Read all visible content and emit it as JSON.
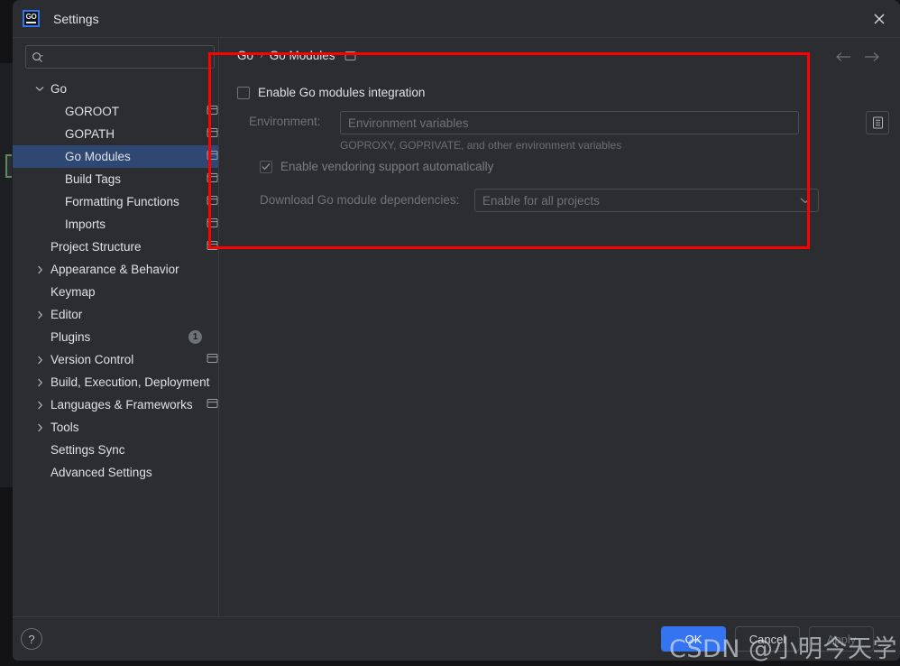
{
  "window": {
    "title": "Settings",
    "app_icon": "goland-go-icon",
    "icon_text": "GO",
    "close_icon": "close-icon",
    "accent_color": "#3574f0",
    "selection_color": "#2f4773",
    "annotation_color": "#fe0000"
  },
  "search": {
    "placeholder": "",
    "value": "",
    "icon": "search-icon"
  },
  "sidebar": {
    "items": [
      {
        "label": "Go",
        "level": 0,
        "arrow": "chevron-down",
        "scope_icon": false,
        "selected": false
      },
      {
        "label": "GOROOT",
        "level": 1,
        "arrow": "",
        "scope_icon": true,
        "selected": false
      },
      {
        "label": "GOPATH",
        "level": 1,
        "arrow": "",
        "scope_icon": true,
        "selected": false
      },
      {
        "label": "Go Modules",
        "level": 1,
        "arrow": "",
        "scope_icon": true,
        "selected": true
      },
      {
        "label": "Build Tags",
        "level": 1,
        "arrow": "",
        "scope_icon": true,
        "selected": false
      },
      {
        "label": "Formatting Functions",
        "level": 1,
        "arrow": "",
        "scope_icon": true,
        "selected": false
      },
      {
        "label": "Imports",
        "level": 1,
        "arrow": "",
        "scope_icon": true,
        "selected": false
      },
      {
        "label": "Project Structure",
        "level": 0,
        "arrow": "",
        "scope_icon": true,
        "selected": false
      },
      {
        "label": "Appearance & Behavior",
        "level": 0,
        "arrow": "chevron-right",
        "scope_icon": false,
        "selected": false
      },
      {
        "label": "Keymap",
        "level": 0,
        "arrow": "",
        "scope_icon": false,
        "selected": false
      },
      {
        "label": "Editor",
        "level": 0,
        "arrow": "chevron-right",
        "scope_icon": false,
        "selected": false
      },
      {
        "label": "Plugins",
        "level": 0,
        "arrow": "",
        "scope_icon": false,
        "selected": false,
        "badge": "1"
      },
      {
        "label": "Version Control",
        "level": 0,
        "arrow": "chevron-right",
        "scope_icon": true,
        "selected": false
      },
      {
        "label": "Build, Execution, Deployment",
        "level": 0,
        "arrow": "chevron-right",
        "scope_icon": false,
        "selected": false
      },
      {
        "label": "Languages & Frameworks",
        "level": 0,
        "arrow": "chevron-right",
        "scope_icon": true,
        "selected": false
      },
      {
        "label": "Tools",
        "level": 0,
        "arrow": "chevron-right",
        "scope_icon": false,
        "selected": false
      },
      {
        "label": "Settings Sync",
        "level": 0,
        "arrow": "",
        "scope_icon": false,
        "selected": false
      },
      {
        "label": "Advanced Settings",
        "level": 0,
        "arrow": "",
        "scope_icon": false,
        "selected": false
      }
    ]
  },
  "content": {
    "breadcrumb": {
      "root": "Go",
      "separator": "›",
      "current": "Go Modules",
      "scope_icon": "project-scope-icon"
    },
    "nav": {
      "back_icon": "arrow-left-icon",
      "forward_icon": "arrow-right-icon"
    },
    "enable_modules": {
      "label": "Enable Go modules integration",
      "checked": false,
      "enabled": true
    },
    "environment": {
      "label": "Environment:",
      "value": "",
      "placeholder": "Environment variables",
      "hint": "GOPROXY, GOPRIVATE, and other environment variables",
      "browse_icon": "edit-variables-icon",
      "enabled": false
    },
    "vendoring": {
      "label": "Enable vendoring support automatically",
      "checked": true,
      "enabled": false
    },
    "download_deps": {
      "label": "Download Go module dependencies:",
      "value": "Enable for all projects",
      "chevron_icon": "chevron-down-icon",
      "enabled": false
    }
  },
  "footer": {
    "help_label": "?",
    "help_icon": "help-icon",
    "buttons": [
      {
        "label": "OK",
        "style": "primary"
      },
      {
        "label": "Cancel",
        "style": "normal"
      },
      {
        "label": "Apply",
        "style": "disabled"
      }
    ]
  },
  "watermark": {
    "text": "CSDN @小明今天学习了吗"
  }
}
